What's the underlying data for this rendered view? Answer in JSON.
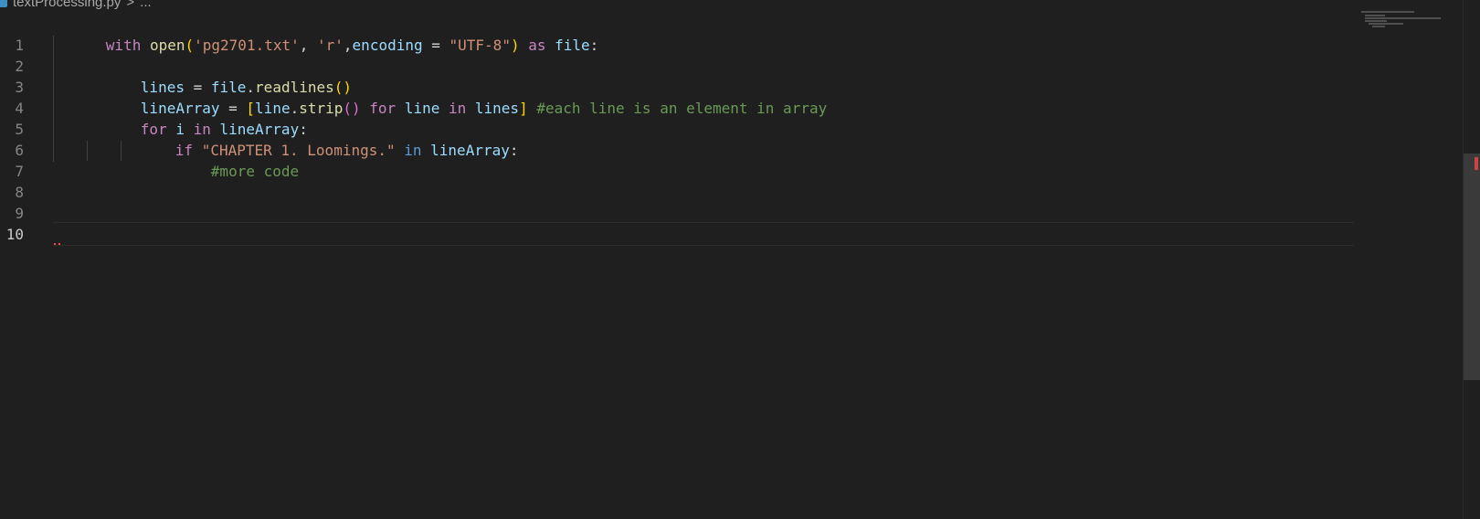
{
  "breadcrumb": {
    "file_icon": "python-file-icon",
    "file": "textProcessing.py",
    "separator": ">",
    "more": "..."
  },
  "editor": {
    "active_line": 10,
    "lines": [
      {
        "number": "1"
      },
      {
        "number": "2"
      },
      {
        "number": "3"
      },
      {
        "number": "4"
      },
      {
        "number": "5"
      },
      {
        "number": "6"
      },
      {
        "number": "7"
      },
      {
        "number": "8"
      },
      {
        "number": "9"
      },
      {
        "number": "10"
      }
    ],
    "tokens": {
      "l1_with": "with",
      "l1_open": "open",
      "l1_paren_open": "(",
      "l1_file_str": "'pg2701.txt'",
      "l1_comma1": ", ",
      "l1_mode_str": "'r'",
      "l1_comma2": ",",
      "l1_encoding": "encoding",
      "l1_eq": " = ",
      "l1_enc_str": "\"UTF-8\"",
      "l1_paren_close": ")",
      "l1_as": " as ",
      "l1_file": "file",
      "l1_colon": ":",
      "l3_lines": "lines",
      "l3_eq": " = ",
      "l3_file": "file",
      "l3_dot": ".",
      "l3_readlines": "readlines",
      "l3_parens": "()",
      "l4_linearray": "lineArray",
      "l4_eq": " = ",
      "l4_lbracket": "[",
      "l4_line": "line",
      "l4_dot": ".",
      "l4_strip": "strip",
      "l4_parens": "()",
      "l4_for": " for ",
      "l4_line2": "line",
      "l4_in": " in ",
      "l4_lines": "lines",
      "l4_rbracket": "]",
      "l4_comment": " #each line is an element in array",
      "l5_for": "for",
      "l5_i": " i",
      "l5_in": " in ",
      "l5_linearray": "lineArray",
      "l5_colon": ":",
      "l6_if": "if",
      "l6_str": " \"CHAPTER 1. Loomings.\"",
      "l6_in": " in ",
      "l6_linearray": "lineArray",
      "l6_colon": ":",
      "l7_comment": "#more code"
    }
  },
  "colors": {
    "background": "#1f1f1f",
    "keyword_control": "#c586c0",
    "keyword": "#569cd6",
    "function": "#dcdcaa",
    "string": "#ce9178",
    "variable": "#9cdcfe",
    "comment": "#6a9955",
    "error": "#f14c4c"
  }
}
